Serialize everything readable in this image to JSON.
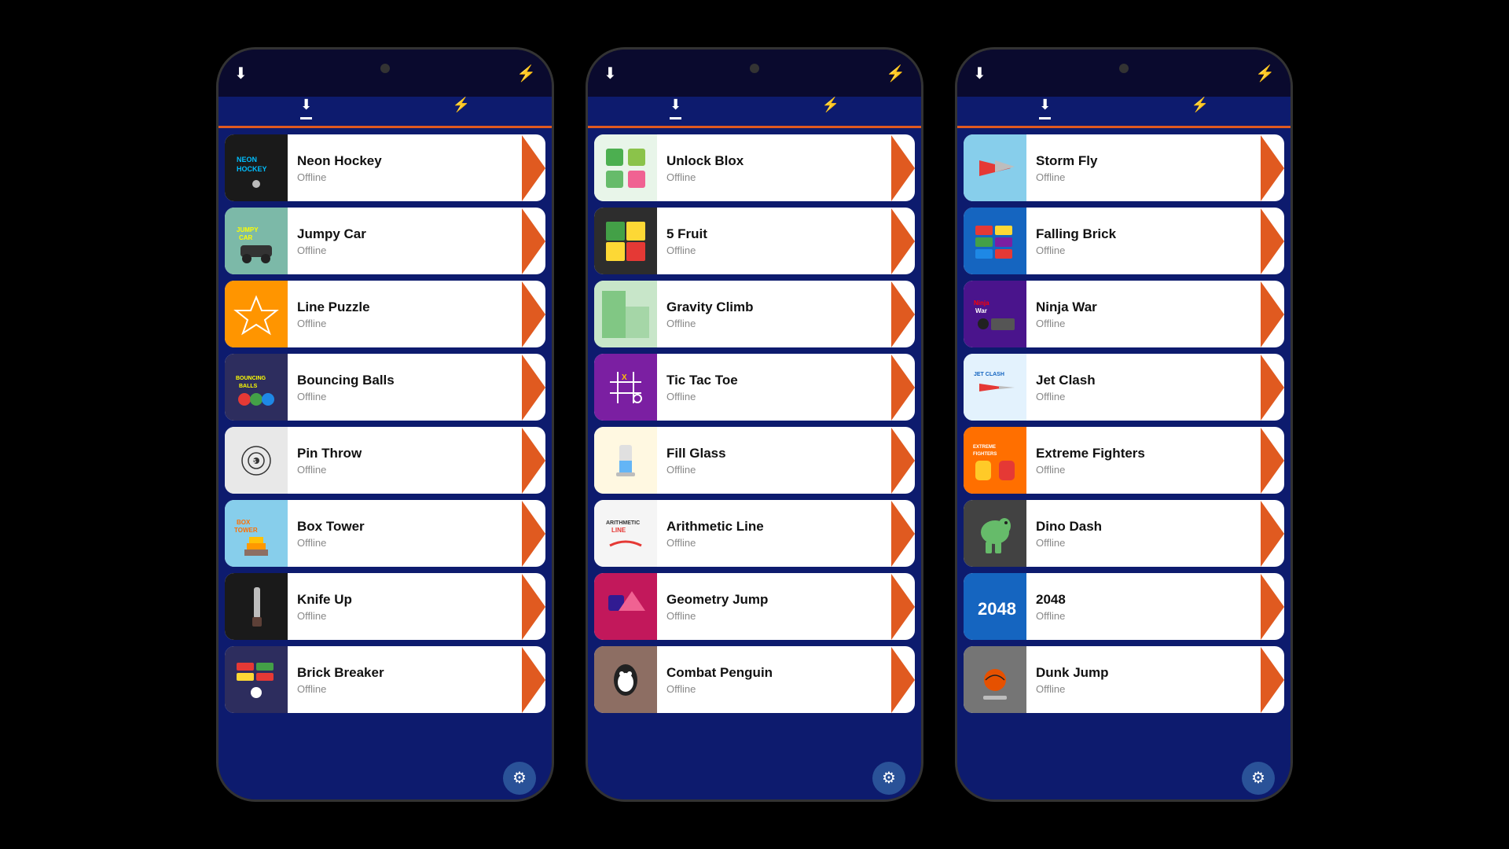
{
  "phones": [
    {
      "id": "phone1",
      "games": [
        {
          "name": "Neon Hockey",
          "status": "Offline",
          "icon": "🏒",
          "thumbClass": "thumb-neon-hockey"
        },
        {
          "name": "Jumpy Car",
          "status": "Offline",
          "icon": "🚗",
          "thumbClass": "thumb-jumpy-car"
        },
        {
          "name": "Line Puzzle",
          "status": "Offline",
          "icon": "⭐",
          "thumbClass": "thumb-line-puzzle"
        },
        {
          "name": "Bouncing Balls",
          "status": "Offline",
          "icon": "🎱",
          "thumbClass": "thumb-bouncing-balls"
        },
        {
          "name": "Pin Throw",
          "status": "Offline",
          "icon": "📌",
          "thumbClass": "thumb-pin-throw"
        },
        {
          "name": "Box Tower",
          "status": "Offline",
          "icon": "📦",
          "thumbClass": "thumb-box-tower"
        },
        {
          "name": "Knife Up",
          "status": "Offline",
          "icon": "🔪",
          "thumbClass": "thumb-knife-up"
        },
        {
          "name": "Brick Breaker",
          "status": "Offline",
          "icon": "🧱",
          "thumbClass": "thumb-brick-breaker"
        }
      ]
    },
    {
      "id": "phone2",
      "games": [
        {
          "name": "Unlock Blox",
          "status": "Offline",
          "icon": "🟩",
          "thumbClass": "thumb-unlock-blox"
        },
        {
          "name": "5 Fruit",
          "status": "Offline",
          "icon": "🍎",
          "thumbClass": "thumb-5-fruit"
        },
        {
          "name": "Gravity Climb",
          "status": "Offline",
          "icon": "🌿",
          "thumbClass": "thumb-gravity-climb"
        },
        {
          "name": "Tic Tac Toe",
          "status": "Offline",
          "icon": "⭕",
          "thumbClass": "thumb-tic-tac-toe"
        },
        {
          "name": "Fill Glass",
          "status": "Offline",
          "icon": "🥛",
          "thumbClass": "thumb-fill-glass"
        },
        {
          "name": "Arithmetic Line",
          "status": "Offline",
          "icon": "➕",
          "thumbClass": "thumb-arithmetic"
        },
        {
          "name": "Geometry Jump",
          "status": "Offline",
          "icon": "🔺",
          "thumbClass": "thumb-geometry-jump"
        },
        {
          "name": "Combat Penguin",
          "status": "Offline",
          "icon": "🐧",
          "thumbClass": "thumb-combat-penguin"
        }
      ]
    },
    {
      "id": "phone3",
      "games": [
        {
          "name": "Storm Fly",
          "status": "Offline",
          "icon": "✈️",
          "thumbClass": "thumb-storm-fly"
        },
        {
          "name": "Falling Brick",
          "status": "Offline",
          "icon": "🟦",
          "thumbClass": "thumb-falling-brick"
        },
        {
          "name": "Ninja War",
          "status": "Offline",
          "icon": "🥷",
          "thumbClass": "thumb-ninja-war"
        },
        {
          "name": "Jet Clash",
          "status": "Offline",
          "icon": "🛩️",
          "thumbClass": "thumb-jet-clash"
        },
        {
          "name": "Extreme Fighters",
          "status": "Offline",
          "icon": "🥊",
          "thumbClass": "thumb-extreme-fighters"
        },
        {
          "name": "Dino Dash",
          "status": "Offline",
          "icon": "🦕",
          "thumbClass": "thumb-dino-dash"
        },
        {
          "name": "2048",
          "status": "Offline",
          "icon": "🔢",
          "thumbClass": "thumb-2048"
        },
        {
          "name": "Dunk Jump",
          "status": "Offline",
          "icon": "🏀",
          "thumbClass": "thumb-dunk-jump"
        }
      ]
    }
  ],
  "header": {
    "download_icon": "⬇",
    "flash_icon": "⚡"
  },
  "settings_label": "⚙"
}
